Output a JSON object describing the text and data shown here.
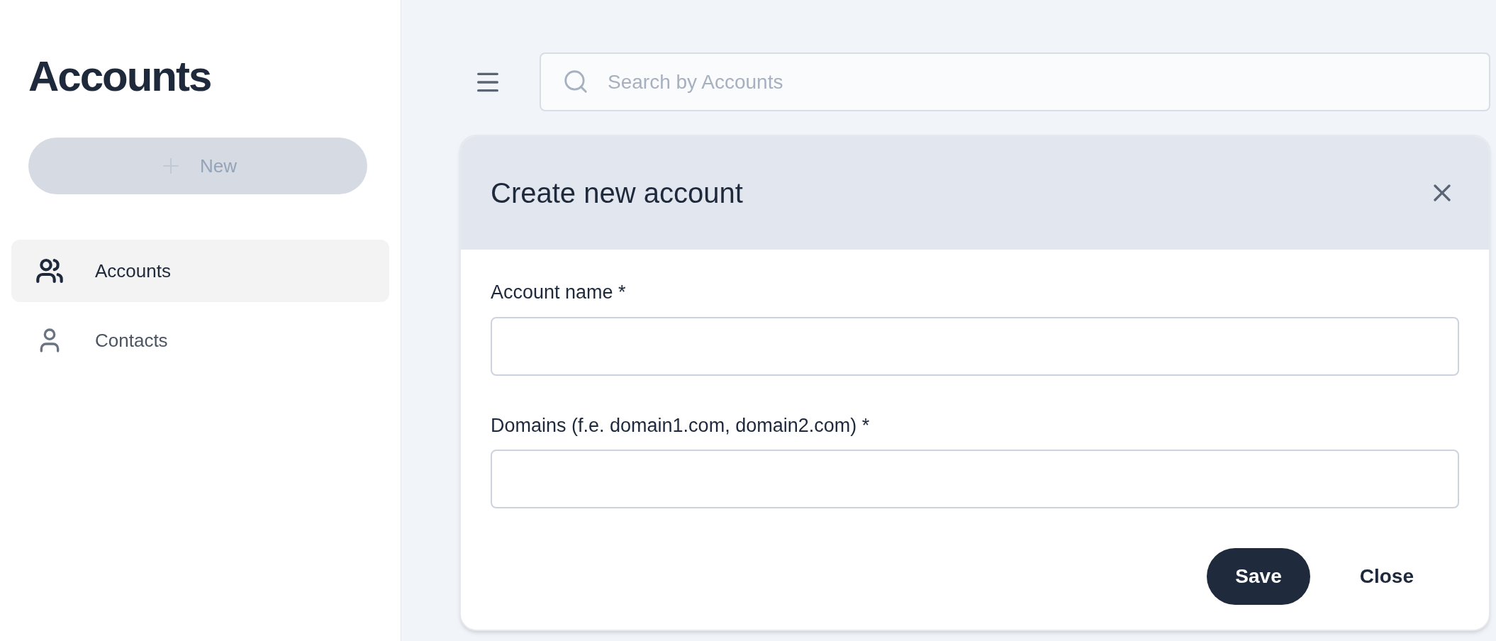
{
  "sidebar": {
    "title": "Accounts",
    "new_button": {
      "label": "New",
      "disabled": true
    },
    "items": [
      {
        "label": "Accounts",
        "kind": "group",
        "selected": true
      },
      {
        "label": "Contacts",
        "kind": "person",
        "selected": false
      }
    ]
  },
  "search": {
    "placeholder": "Search by Accounts"
  },
  "dialog": {
    "title": "Create new account",
    "fields": [
      {
        "label": "Account name *"
      },
      {
        "label": "Domains (f.e. domain1.com, domain2.com) *"
      }
    ],
    "buttons": [
      {
        "label": "Save",
        "kind": "primary"
      },
      {
        "label": "Close",
        "kind": "plain"
      }
    ]
  }
}
